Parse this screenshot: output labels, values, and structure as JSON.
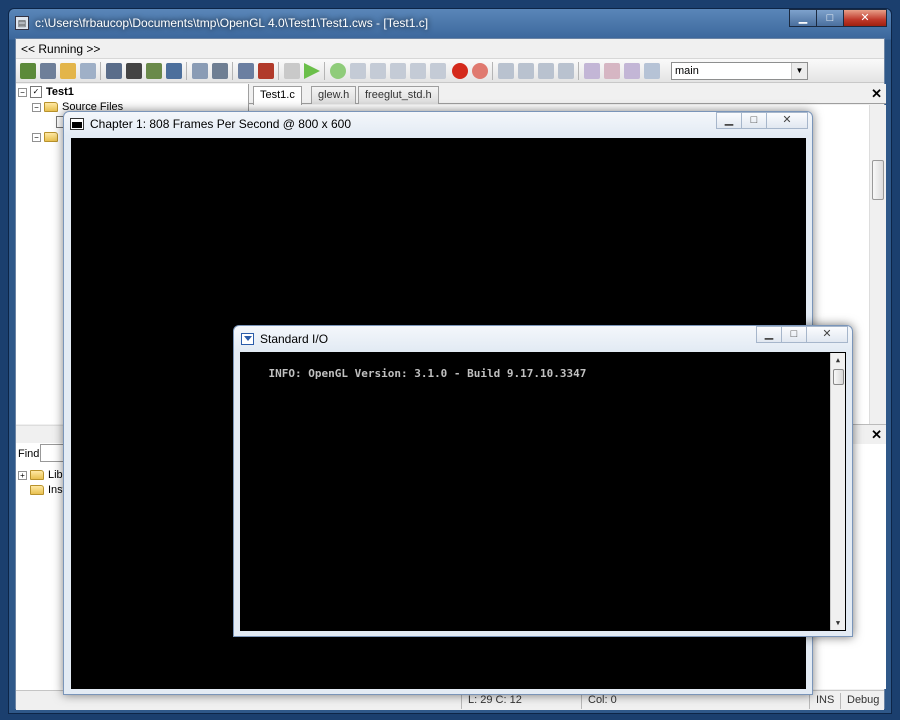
{
  "ide": {
    "title": "c:\\Users\\frbaucop\\Documents\\tmp\\OpenGL 4.0\\Test1\\Test1.cws - [Test1.c]",
    "caption_buttons": {
      "minimize": "▁",
      "maximize": "□",
      "close": "✕"
    },
    "menu": {
      "running": "<< Running >>"
    },
    "toolbar": {
      "function_combo": "main"
    },
    "tree": {
      "project": "Test1",
      "source_files": "Source Files"
    },
    "find": {
      "label": "Find",
      "items": [
        "Libr",
        "Inst"
      ]
    },
    "tabs": [
      "Test1.c",
      "glew.h",
      "freeglut_std.h"
    ],
    "status": {
      "ins": "INS",
      "mode": "Debug",
      "pos": "L: 29 C: 12",
      "misc": "Col: 0"
    }
  },
  "gl_window": {
    "title": "Chapter 1: 808 Frames Per Second @ 800 x 600"
  },
  "stdio_window": {
    "title": "Standard I/O",
    "output": "INFO: OpenGL Version: 3.1.0 - Build 9.17.10.3347"
  }
}
